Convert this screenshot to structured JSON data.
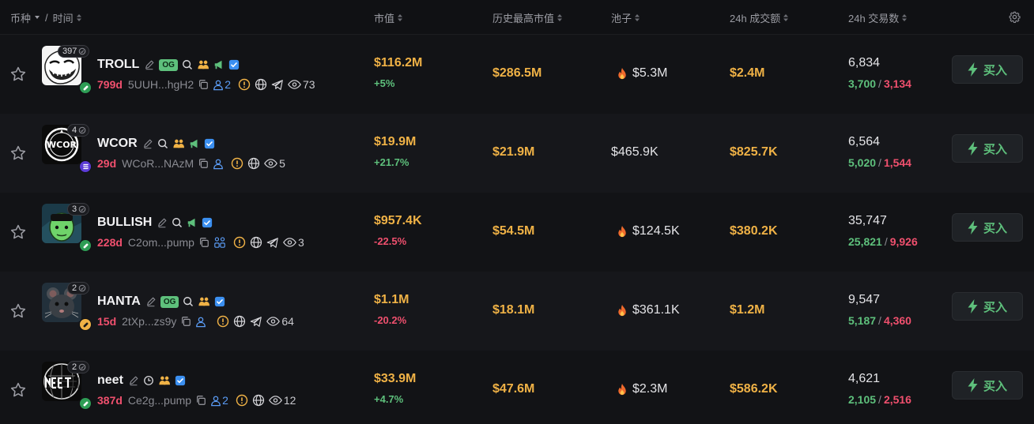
{
  "header": {
    "col_token": "币种",
    "col_sep": "/",
    "col_time": "时间",
    "col_mcap": "市值",
    "col_ath": "历史最高市值",
    "col_pool": "池子",
    "col_vol": "24h 成交额",
    "col_txs": "24h 交易数"
  },
  "rows": [
    {
      "holders": "397",
      "symbol": "TROLL",
      "og": "OG",
      "age": "799d",
      "address": "5UUH...hgH2",
      "dev_count": "2",
      "views": "73",
      "mcap": "$116.2M",
      "change": "+5%",
      "ath": "$286.5M",
      "pool": "$5.3M",
      "volume": "$2.4M",
      "txs": "6,834",
      "buys": "3,700",
      "sells": "3,134",
      "buy_label": "买入"
    },
    {
      "holders": "4",
      "symbol": "WCOR",
      "age": "29d",
      "address": "WCoR...NAzM",
      "views": "5",
      "mcap": "$19.9M",
      "change": "+21.7%",
      "ath": "$21.9M",
      "pool": "$465.9K",
      "volume": "$825.7K",
      "txs": "6,564",
      "buys": "5,020",
      "sells": "1,544",
      "buy_label": "买入"
    },
    {
      "holders": "3",
      "symbol": "BULLISH",
      "age": "228d",
      "address": "C2om...pump",
      "views": "3",
      "mcap": "$957.4K",
      "change": "-22.5%",
      "ath": "$54.5M",
      "pool": "$124.5K",
      "volume": "$380.2K",
      "txs": "35,747",
      "buys": "25,821",
      "sells": "9,926",
      "buy_label": "买入"
    },
    {
      "holders": "2",
      "symbol": "HANTA",
      "og": "OG",
      "age": "15d",
      "address": "2tXp...zs9y",
      "views": "64",
      "mcap": "$1.1M",
      "change": "-20.2%",
      "ath": "$18.1M",
      "pool": "$361.1K",
      "volume": "$1.2M",
      "txs": "9,547",
      "buys": "5,187",
      "sells": "4,360",
      "buy_label": "买入"
    },
    {
      "holders": "2",
      "symbol": "neet",
      "age": "387d",
      "address": "Ce2g...pump",
      "dev_count": "2",
      "views": "12",
      "mcap": "$33.9M",
      "change": "+4.7%",
      "ath": "$47.6M",
      "pool": "$2.3M",
      "volume": "$586.2K",
      "txs": "4,621",
      "buys": "2,105",
      "sells": "2,516",
      "buy_label": "买入"
    }
  ],
  "colors": {
    "accent_green": "#5ec07c",
    "accent_red": "#f0506e",
    "amount_orange": "#f0b246",
    "link_blue": "#5b9cf5",
    "background": "#101114"
  },
  "icons": [
    "star-icon",
    "edit-icon",
    "search-icon",
    "people-icon",
    "megaphone-icon",
    "verified-icon",
    "copy-icon",
    "user-icon",
    "warning-icon",
    "globe-icon",
    "telegram-icon",
    "eye-icon",
    "fire-icon",
    "lightning-icon",
    "gear-icon",
    "clock-icon"
  ]
}
